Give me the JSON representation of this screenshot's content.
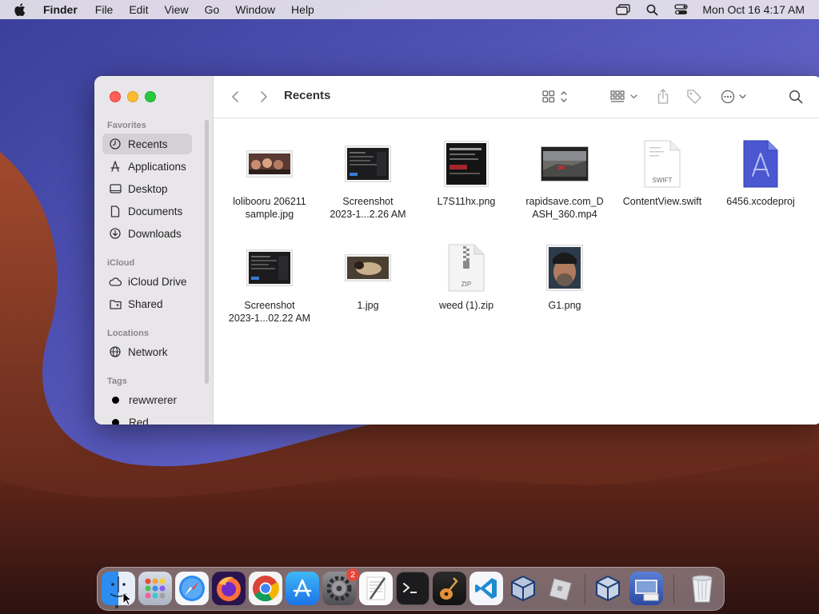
{
  "menubar": {
    "app_name": "Finder",
    "menus": [
      "File",
      "Edit",
      "View",
      "Go",
      "Window",
      "Help"
    ],
    "status_icons": [
      "screen-mirroring-icon",
      "spotlight-search-icon",
      "control-center-icon"
    ],
    "clock": "Mon Oct 16  4:17 AM"
  },
  "window": {
    "title": "Recents",
    "sidebar": {
      "favorites_header": "Favorites",
      "favorites": [
        {
          "label": "Recents",
          "icon": "clock-icon",
          "selected": true
        },
        {
          "label": "Applications",
          "icon": "applications-icon"
        },
        {
          "label": "Desktop",
          "icon": "desktop-icon"
        },
        {
          "label": "Documents",
          "icon": "document-icon"
        },
        {
          "label": "Downloads",
          "icon": "download-icon"
        }
      ],
      "icloud_header": "iCloud",
      "icloud": [
        {
          "label": "iCloud Drive",
          "icon": "cloud-icon"
        },
        {
          "label": "Shared",
          "icon": "shared-folder-icon"
        }
      ],
      "locations_header": "Locations",
      "locations": [
        {
          "label": "Network",
          "icon": "globe-icon"
        }
      ],
      "tags_header": "Tags",
      "tags": [
        {
          "label": "rewwrerer",
          "color": "#000000"
        },
        {
          "label": "Red",
          "color": "#000000"
        }
      ]
    },
    "files": [
      {
        "name": "lolibooru 206211 sample.jpg",
        "line1": "lolibooru 206211",
        "line2": "sample.jpg",
        "kind": "image"
      },
      {
        "name": "Screenshot 2023-1...2.26 AM",
        "line1": "Screenshot",
        "line2": "2023-1...2.26 AM",
        "kind": "screenshot"
      },
      {
        "name": "L7S11hx.png",
        "line1": "L7S11hx.png",
        "line2": "",
        "kind": "dark-image"
      },
      {
        "name": "rapidsave.com_DASH_360.mp4",
        "line1": "rapidsave.com_D",
        "line2": "ASH_360.mp4",
        "kind": "video"
      },
      {
        "name": "ContentView.swift",
        "line1": "ContentView.swift",
        "line2": "",
        "kind": "swift",
        "badge": "SWIFT"
      },
      {
        "name": "6456.xcodeproj",
        "line1": "6456.xcodeproj",
        "line2": "",
        "kind": "xcodeproj"
      },
      {
        "name": "Screenshot 2023-1...02.22 AM",
        "line1": "Screenshot",
        "line2": "2023-1...02.22 AM",
        "kind": "screenshot"
      },
      {
        "name": "1.jpg",
        "line1": "1.jpg",
        "line2": "",
        "kind": "photo"
      },
      {
        "name": "weed (1).zip",
        "line1": "weed (1).zip",
        "line2": "",
        "kind": "zip",
        "badge": "ZIP"
      },
      {
        "name": "G1.png",
        "line1": "G1.png",
        "line2": "",
        "kind": "portrait"
      }
    ]
  },
  "dock": {
    "apps": [
      "Finder",
      "Launchpad",
      "Safari",
      "Firefox",
      "Chrome",
      "App Store",
      "System Settings",
      "TextEdit",
      "Terminal",
      "GarageBand",
      "VS Code",
      "VirtualBox",
      "Roblox",
      "VirtualBox VM",
      "Preview",
      "Trash"
    ],
    "settings_badge": "2"
  }
}
